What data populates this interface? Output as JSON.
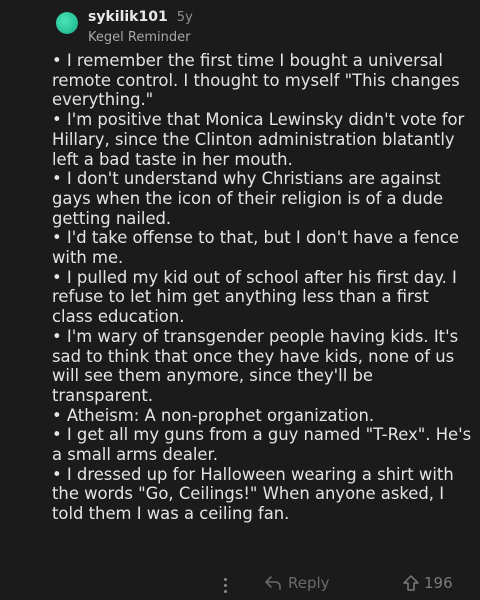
{
  "comment": {
    "username": "sykilik101",
    "age": "5y",
    "flair": "Kegel Reminder",
    "lines": [
      "• I remember the first time I bought a universal remote control. I thought to myself \"This changes everything.\"",
      "• I'm positive that Monica Lewinsky didn't vote for Hillary, since the Clinton administration blatantly left a bad taste in her mouth.",
      "• I don't understand why Christians are against gays when the icon of their religion is of a dude getting nailed.",
      "• I'd take offense to that, but I don't have a fence with me.",
      "• I pulled my kid out of school after his first day. I refuse to let him get anything less than a first class education.",
      "• I'm wary of transgender people having kids. It's sad to think that once they have kids, none of us will see them anymore, since they'll be transparent.",
      "• Atheism: A non-prophet organization.",
      "• I get all my guns from a guy named \"T-Rex\". He's a small arms dealer.",
      "• I dressed up for Halloween wearing a shirt with the words \"Go, Ceilings!\" When anyone asked, I told them I was a ceiling fan."
    ]
  },
  "actions": {
    "reply_label": "Reply",
    "upvote_count": "196",
    "more_icon": "more-vertical-icon",
    "reply_icon": "reply-arrow-icon",
    "upvote_icon": "upvote-arrow-icon"
  },
  "colors": {
    "background": "#1b1b1b",
    "avatar": "#2cc79d",
    "text": "#e4e4e4",
    "muted": "#8e8e8e"
  }
}
